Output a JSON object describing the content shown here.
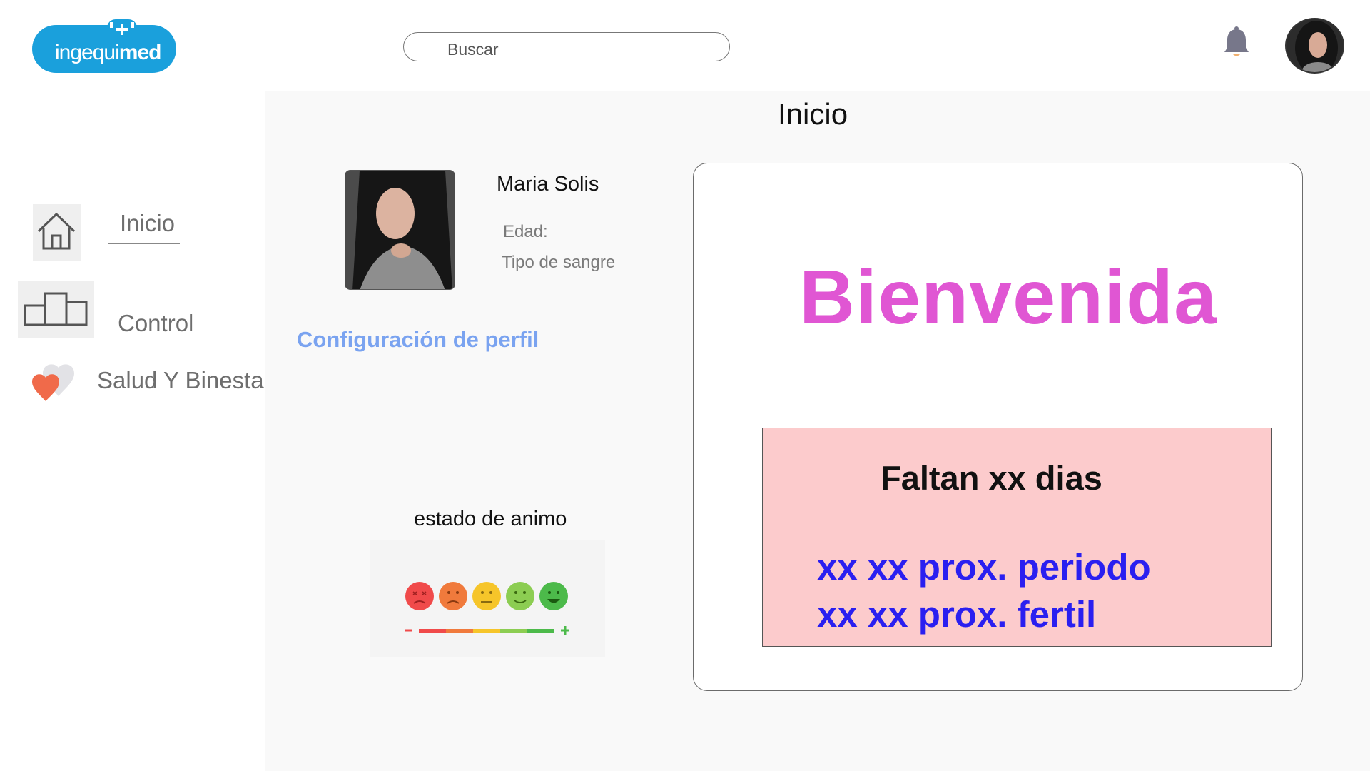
{
  "header": {
    "logo": {
      "text_light": "ingequi",
      "text_bold": "med",
      "color": "#1aa0dc"
    },
    "search": {
      "placeholder": "Buscar"
    },
    "icons": {
      "notifications": "bell-icon",
      "user": "user-avatar"
    }
  },
  "sidebar": {
    "items": [
      {
        "label": "Inicio",
        "icon": "home-icon",
        "active": true
      },
      {
        "label": "Control",
        "icon": "podium-icon",
        "active": false
      },
      {
        "label": "Salud Y Binestar",
        "icon": "heart-icon",
        "active": false
      }
    ]
  },
  "main": {
    "title": "Inicio",
    "profile": {
      "name": "Maria Solis",
      "age_label": "Edad:",
      "blood_label": "Tipo de sangre",
      "config_link": "Configuración de perfil"
    },
    "mood": {
      "title": "estado de animo",
      "faces": [
        "very-sad",
        "sad",
        "neutral",
        "happy",
        "very-happy"
      ],
      "colors": [
        "#f04a4a",
        "#f07a3c",
        "#f6c52a",
        "#8ccd52",
        "#4cba4a"
      ]
    },
    "welcome_card": {
      "greeting": "Bienvenida",
      "countdown": "Faltan xx dias",
      "next_period": "xx xx prox. periodo",
      "next_fertile": "xx xx prox. fertil"
    }
  },
  "colors": {
    "greeting": "#e056d3",
    "link": "#7aa3f0",
    "highlight_box": "#fccbcc",
    "dates": "#2a1ff0"
  }
}
